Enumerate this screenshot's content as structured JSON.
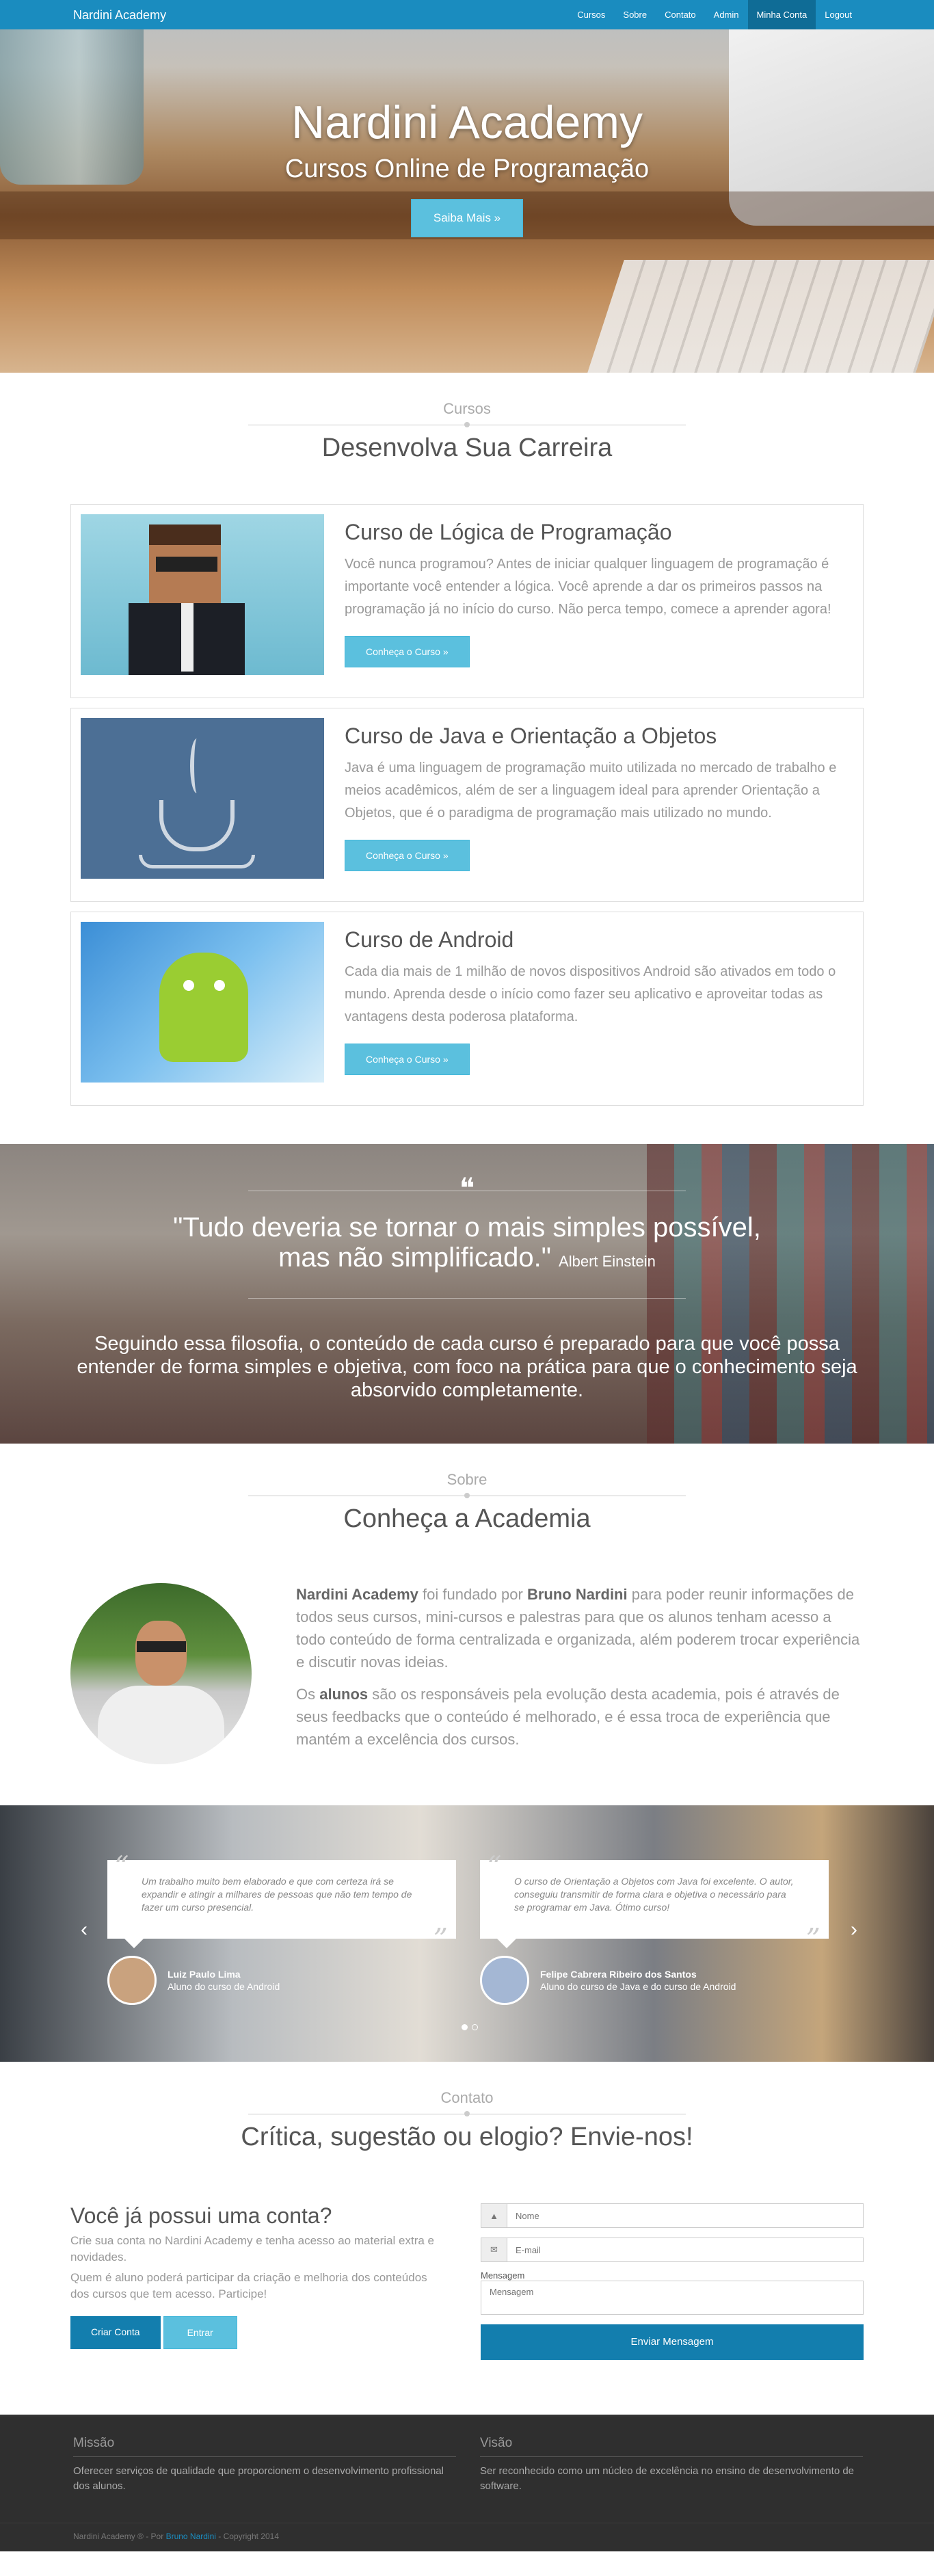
{
  "nav": {
    "brand": "Nardini Academy",
    "items": [
      "Cursos",
      "Sobre",
      "Contato",
      "Admin",
      "Minha Conta",
      "Logout"
    ]
  },
  "hero": {
    "title": "Nardini Academy",
    "subtitle": "Cursos Online de Programação",
    "button": "Saiba Mais »"
  },
  "courses_section": {
    "small": "Cursos",
    "big": "Desenvolva Sua Carreira",
    "items": [
      {
        "title": "Curso de Lógica de Programação",
        "text": "Você nunca programou? Antes de iniciar qualquer linguagem de programação é importante você entender a lógica. Você aprende a dar os primeiros passos na programação já no início do curso. Não perca tempo, comece a aprender agora!",
        "button": "Conheça o Curso »"
      },
      {
        "title": "Curso de Java e Orientação a Objetos",
        "text": "Java é uma linguagem de programação muito utilizada no mercado de trabalho e meios acadêmicos, além de ser a linguagem ideal para aprender Orientação a Objetos, que é o paradigma de programação mais utilizado no mundo.",
        "button": "Conheça o Curso »"
      },
      {
        "title": "Curso de Android",
        "text": "Cada dia mais de 1 milhão de novos dispositivos Android são ativados em todo o mundo. Aprenda desde o início como fazer seu aplicativo e aproveitar todas as vantagens desta poderosa plataforma.",
        "button": "Conheça o Curso »"
      }
    ]
  },
  "quote": {
    "mark": "❝",
    "line1": "\"Tudo deveria se tornar o mais simples possível,",
    "line2": "mas não simplificado.\"",
    "author": "Albert Einstein",
    "description": "Seguindo essa filosofia, o conteúdo de cada curso é preparado para que você possa entender de forma simples e objetiva, com foco na prática para que o conhecimento seja absorvido completamente."
  },
  "about": {
    "small": "Sobre",
    "big": "Conheça a Academia",
    "p1_brand": "Nardini Academy",
    "p1_mid": " foi fundado por ",
    "p1_founder": "Bruno Nardini",
    "p1_end": " para poder reunir informações de todos seus cursos, mini-cursos e palestras para que os alunos tenham acesso a todo conteúdo de forma centralizada e organizada, além poderem trocar experiência e discutir novas ideias.",
    "p2_start": "Os ",
    "p2_bold": "alunos",
    "p2_end": " são os responsáveis pela evolução desta academia, pois é através de seus feedbacks que o conteúdo é melhorado, e é essa troca de experiência que mantém a excelência dos cursos."
  },
  "testimonials": [
    {
      "text": "Um trabalho muito bem elaborado e que com certeza irá se expandir e atingir a milhares de pessoas que não tem tempo de fazer um curso presencial.",
      "name": "Luiz Paulo Lima",
      "role": "Aluno do curso de Android"
    },
    {
      "text": "O curso de Orientação a Objetos com Java foi excelente. O autor, conseguiu transmitir de forma clara e objetiva o necessário para se programar em Java. Ótimo curso!",
      "name": "Felipe Cabrera Ribeiro dos Santos",
      "role": "Aluno do curso de Java e do curso de Android"
    }
  ],
  "contact": {
    "small": "Contato",
    "big": "Crítica, sugestão ou elogio? Envie-nos!",
    "account_title": "Você já possui uma conta?",
    "account_p1": "Crie sua conta no Nardini Academy e tenha acesso ao material extra e novidades.",
    "account_p2": "Quem é aluno poderá participar da criação e melhoria dos conteúdos dos cursos que tem acesso. Participe!",
    "create_button": "Criar Conta",
    "login_button": "Entrar",
    "name_placeholder": "Nome",
    "email_placeholder": "E-mail",
    "message_label": "Mensagem",
    "message_placeholder": "Mensagem",
    "send_button": "Enviar Mensagem"
  },
  "footer": {
    "mission_title": "Missão",
    "mission_text": "Oferecer serviços de qualidade que proporcionem o desenvolvimento profissional dos alunos.",
    "vision_title": "Visão",
    "vision_text": "Ser reconhecido como um núcleo de excelência no ensino de desenvolvimento de software.",
    "copy_prefix": "Nardini Academy ® - Por ",
    "copy_author": "Bruno Nardini",
    "copy_suffix": " - Copyright 2014"
  },
  "colors": {
    "accent": "#1a8cbf",
    "button": "#5bc0de",
    "dark_button": "#137eae",
    "footer": "#2f2f2f"
  }
}
